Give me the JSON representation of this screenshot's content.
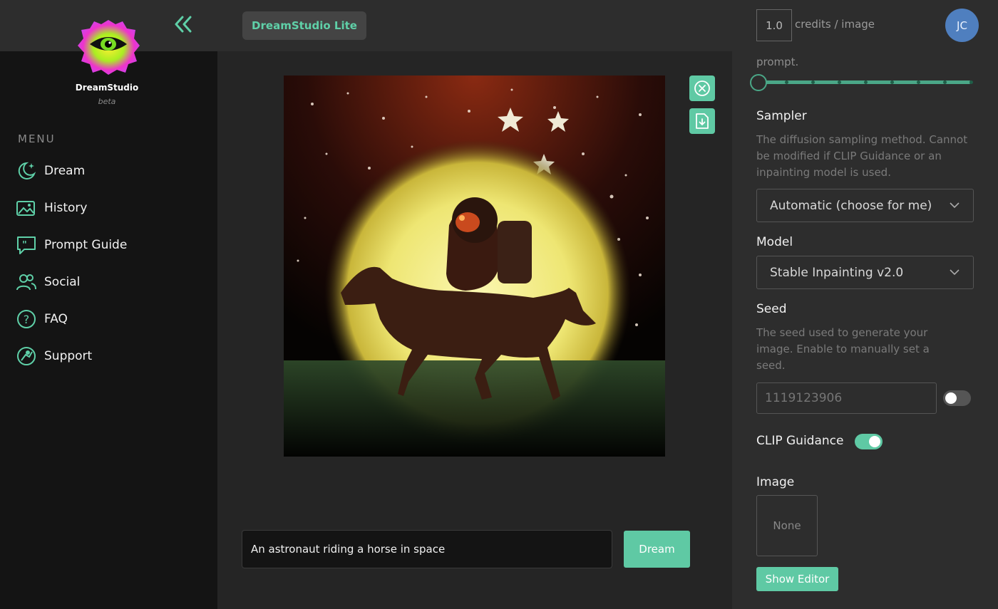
{
  "brand": {
    "name": "DreamStudio",
    "tag": "beta"
  },
  "sidebar": {
    "menu_heading": "MENU",
    "items": [
      {
        "label": "Dream",
        "icon": "moon-stars-icon"
      },
      {
        "label": "History",
        "icon": "image-gallery-icon"
      },
      {
        "label": "Prompt Guide",
        "icon": "quote-bubble-icon"
      },
      {
        "label": "Social",
        "icon": "users-icon"
      },
      {
        "label": "FAQ",
        "icon": "question-circle-icon"
      },
      {
        "label": "Support",
        "icon": "support-icon"
      }
    ]
  },
  "header": {
    "title": "DreamStudio Lite",
    "credits_value": "1.0",
    "credits_label": "credits / image",
    "avatar_initials": "JC"
  },
  "canvas": {
    "prompt_value": "An astronaut riding a horse in space",
    "dream_label": "Dream"
  },
  "settings": {
    "cutoff_text": "prompt.",
    "slider": {
      "value_fraction": 0.0,
      "ticks": 9
    },
    "sampler": {
      "heading": "Sampler",
      "desc": "The diffusion sampling method. Cannot be modified if CLIP Guidance or an inpainting model is used.",
      "selected": "Automatic (choose for me)"
    },
    "model": {
      "heading": "Model",
      "selected": "Stable Inpainting v2.0"
    },
    "seed": {
      "heading": "Seed",
      "desc": "The seed used to generate your image. Enable to manually set a seed.",
      "placeholder": "1119123906",
      "enabled": false
    },
    "clip": {
      "label": "CLIP Guidance",
      "enabled": true
    },
    "image": {
      "heading": "Image",
      "value": "None",
      "show_editor_label": "Show Editor"
    }
  },
  "colors": {
    "accent": "#5fc9a4",
    "sidebar_bg": "#141414",
    "panel_bg": "#2d2d2d",
    "main_bg": "#252525"
  }
}
